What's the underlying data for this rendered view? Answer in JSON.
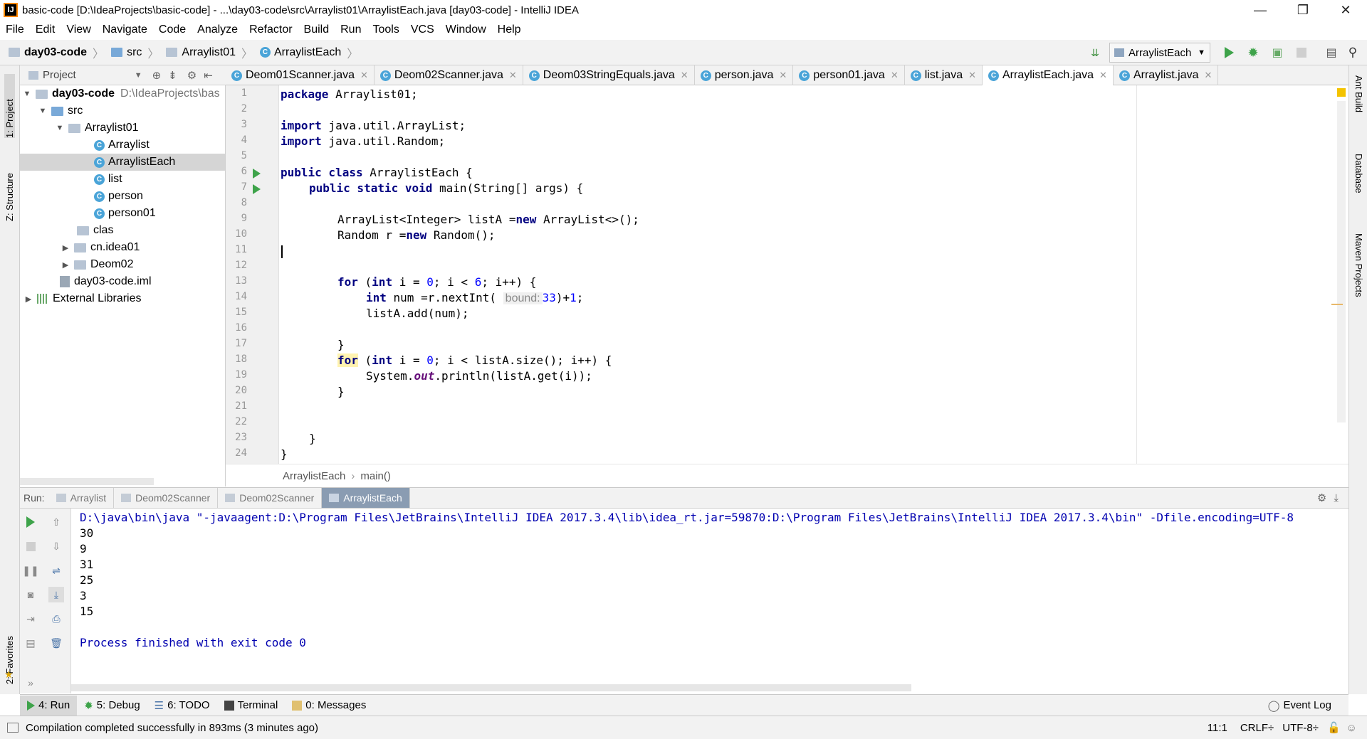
{
  "window": {
    "title": "basic-code [D:\\IdeaProjects\\basic-code] - ...\\day03-code\\src\\Arraylist01\\ArraylistEach.java [day03-code] - IntelliJ IDEA",
    "minimize": "—",
    "maximize": "❐",
    "close": "✕"
  },
  "menu": [
    "File",
    "Edit",
    "View",
    "Navigate",
    "Code",
    "Analyze",
    "Refactor",
    "Build",
    "Run",
    "Tools",
    "VCS",
    "Window",
    "Help"
  ],
  "breadcrumb": {
    "project": "day03-code",
    "src": "src",
    "package": "Arraylist01",
    "file": "ArraylistEach"
  },
  "toolbar": {
    "run_config": "ArraylistEach"
  },
  "project_panel": {
    "title": "Project",
    "tree": [
      {
        "label": "day03-code",
        "path": "D:\\IdeaProjects\\bas",
        "bold": true
      },
      {
        "label": "src"
      },
      {
        "label": "Arraylist01"
      },
      {
        "label": "Arraylist"
      },
      {
        "label": "ArraylistEach"
      },
      {
        "label": "list"
      },
      {
        "label": "person"
      },
      {
        "label": "person01"
      },
      {
        "label": "clas"
      },
      {
        "label": "cn.idea01"
      },
      {
        "label": "Deom02"
      },
      {
        "label": "day03-code.iml"
      },
      {
        "label": "External Libraries"
      }
    ]
  },
  "editor_tabs": [
    {
      "label": "Deom01Scanner.java"
    },
    {
      "label": "Deom02Scanner.java"
    },
    {
      "label": "Deom03StringEquals.java"
    },
    {
      "label": "person.java"
    },
    {
      "label": "person01.java"
    },
    {
      "label": "list.java"
    },
    {
      "label": "ArraylistEach.java",
      "active": true
    },
    {
      "label": "Arraylist.java"
    }
  ],
  "line_numbers": [
    "1",
    "2",
    "3",
    "4",
    "5",
    "6",
    "7",
    "8",
    "9",
    "10",
    "11",
    "12",
    "13",
    "14",
    "15",
    "16",
    "17",
    "18",
    "19",
    "20",
    "21",
    "22",
    "23",
    "24"
  ],
  "code": {
    "l1_kw": "package",
    "l1": " Arraylist01;",
    "l3_kw": "import",
    "l3": " java.util.ArrayList;",
    "l4_kw": "import",
    "l4": " java.util.Random;",
    "l6_kw": "public class",
    "l6": " ArraylistEach {",
    "l7_kw": "public static void",
    "l7": " main(String[] args) {",
    "l9a": "ArrayList<Integer> listA =",
    "l9_kw": "new",
    "l9b": " ArrayList<>();",
    "l10a": "Random r =",
    "l10_kw": "new",
    "l10b": " Random();",
    "l12_kw1": "for",
    "l12a": " (",
    "l12_kw2": "int",
    "l12b": " i = ",
    "l12_n1": "0",
    "l12c": "; i < ",
    "l12_n2": "6",
    "l12d": "; i++) {",
    "l13_kw": "int",
    "l13a": " num =r.nextInt( ",
    "l13_hint": "bound:",
    "l13_n1": "33",
    "l13b": ")+",
    "l13_n2": "1",
    "l13c": ";",
    "l14": "listA.add(num);",
    "l16": "}",
    "l17_kw1": "for",
    "l17a": " (",
    "l17_kw2": "int",
    "l17b": " i = ",
    "l17_n1": "0",
    "l17c": "; i < listA.size(); i++) {",
    "l18a": "System.",
    "l18_fld": "out",
    "l18b": ".println(listA.get(i));",
    "l19": "}",
    "l22": "}",
    "l23": "}"
  },
  "editor_breadcrumb": {
    "class": "ArraylistEach",
    "method": "main()"
  },
  "run_panel": {
    "label": "Run:",
    "tabs": [
      {
        "label": "Arraylist"
      },
      {
        "label": "Deom02Scanner"
      },
      {
        "label": "Deom02Scanner"
      },
      {
        "label": "ArraylistEach",
        "active": true
      }
    ],
    "console": [
      "D:\\java\\bin\\java \"-javaagent:D:\\Program Files\\JetBrains\\IntelliJ IDEA 2017.3.4\\lib\\idea_rt.jar=59870:D:\\Program Files\\JetBrains\\IntelliJ IDEA 2017.3.4\\bin\" -Dfile.encoding=UTF-8",
      "30",
      "9",
      "31",
      "25",
      "3",
      "15",
      "",
      "Process finished with exit code 0"
    ]
  },
  "tool_windows": {
    "run": "4: Run",
    "debug": "5: Debug",
    "todo": "6: TODO",
    "terminal": "Terminal",
    "messages": "0: Messages",
    "event_log": "Event Log"
  },
  "left_strip": {
    "project": "1: Project",
    "structure": "Z: Structure",
    "favorites": "2: Favorites"
  },
  "right_strip": {
    "ant": "Ant Build",
    "database": "Database",
    "maven": "Maven Projects"
  },
  "status": {
    "message": "Compilation completed successfully in 893ms (3 minutes ago)",
    "position": "11:1",
    "line_sep": "CRLF÷",
    "encoding": "UTF-8÷"
  },
  "colors": {
    "keyword": "#000080",
    "number": "#0000ff",
    "run_green": "#3ea34a",
    "active_run_tab": "#8a9cb2"
  }
}
